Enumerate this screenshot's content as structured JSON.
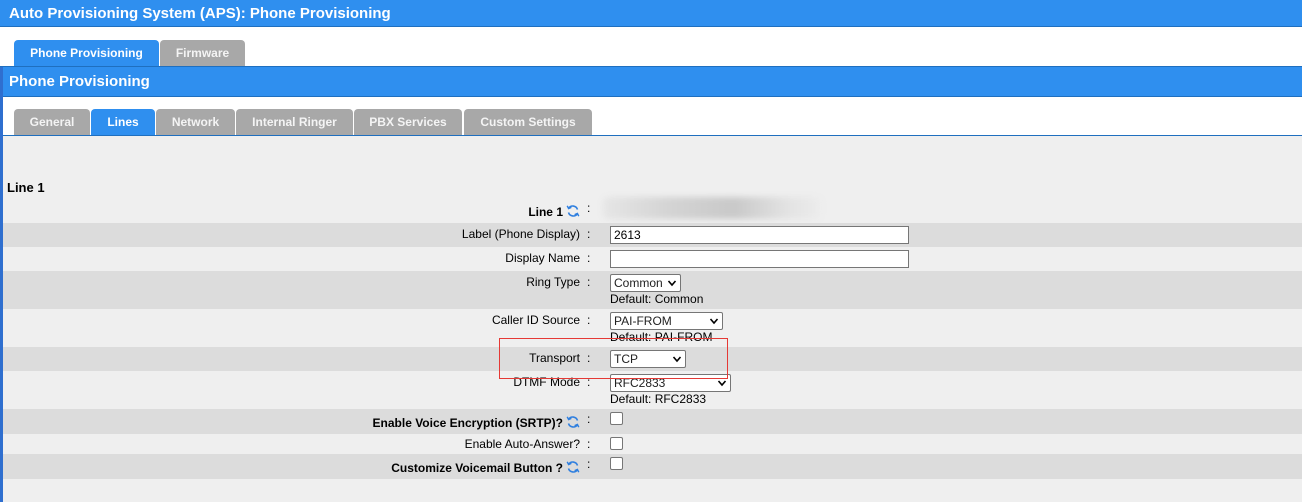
{
  "app": {
    "title": "Auto Provisioning System (APS):  Phone Provisioning"
  },
  "top_tabs": [
    {
      "label": "Phone Provisioning",
      "active": true
    },
    {
      "label": "Firmware",
      "active": false
    }
  ],
  "section": {
    "title": "Phone Provisioning"
  },
  "sub_tabs": [
    {
      "label": "General",
      "active": false
    },
    {
      "label": "Lines",
      "active": true
    },
    {
      "label": "Network",
      "active": false
    },
    {
      "label": "Internal Ringer",
      "active": false
    },
    {
      "label": "PBX Services",
      "active": false
    },
    {
      "label": "Custom Settings",
      "active": false
    }
  ],
  "line_heading": "Line 1",
  "fields": {
    "line1": {
      "label": "Line 1",
      "colon": ":",
      "icon": "refresh-icon"
    },
    "label_display": {
      "label": "Label (Phone Display)",
      "colon": ":",
      "value": "2613"
    },
    "display_name": {
      "label": "Display Name",
      "colon": ":",
      "value": ""
    },
    "ring_type": {
      "label": "Ring Type",
      "colon": ":",
      "selected": "Common",
      "default": "Default: Common"
    },
    "caller_id_source": {
      "label": "Caller ID Source",
      "colon": ":",
      "selected": "PAI-FROM",
      "default": "Default: PAI-FROM"
    },
    "transport": {
      "label": "Transport",
      "colon": ":",
      "selected": "TCP"
    },
    "dtmf_mode": {
      "label": "DTMF Mode",
      "colon": ":",
      "selected": "RFC2833",
      "default": "Default: RFC2833"
    },
    "srtp": {
      "label": "Enable Voice Encryption (SRTP)?",
      "colon": ":",
      "checked": false,
      "icon": "refresh-icon"
    },
    "auto_answer": {
      "label": "Enable Auto-Answer?",
      "colon": ":",
      "checked": false
    },
    "voicemail_button": {
      "label": "Customize Voicemail Button ?",
      "colon": ":",
      "checked": false,
      "icon": "refresh-icon"
    }
  },
  "colors": {
    "accent": "#2f8fef",
    "tab_inactive": "#a8a8a8",
    "highlight": "#e53935",
    "shade": "#dcdcdc"
  }
}
